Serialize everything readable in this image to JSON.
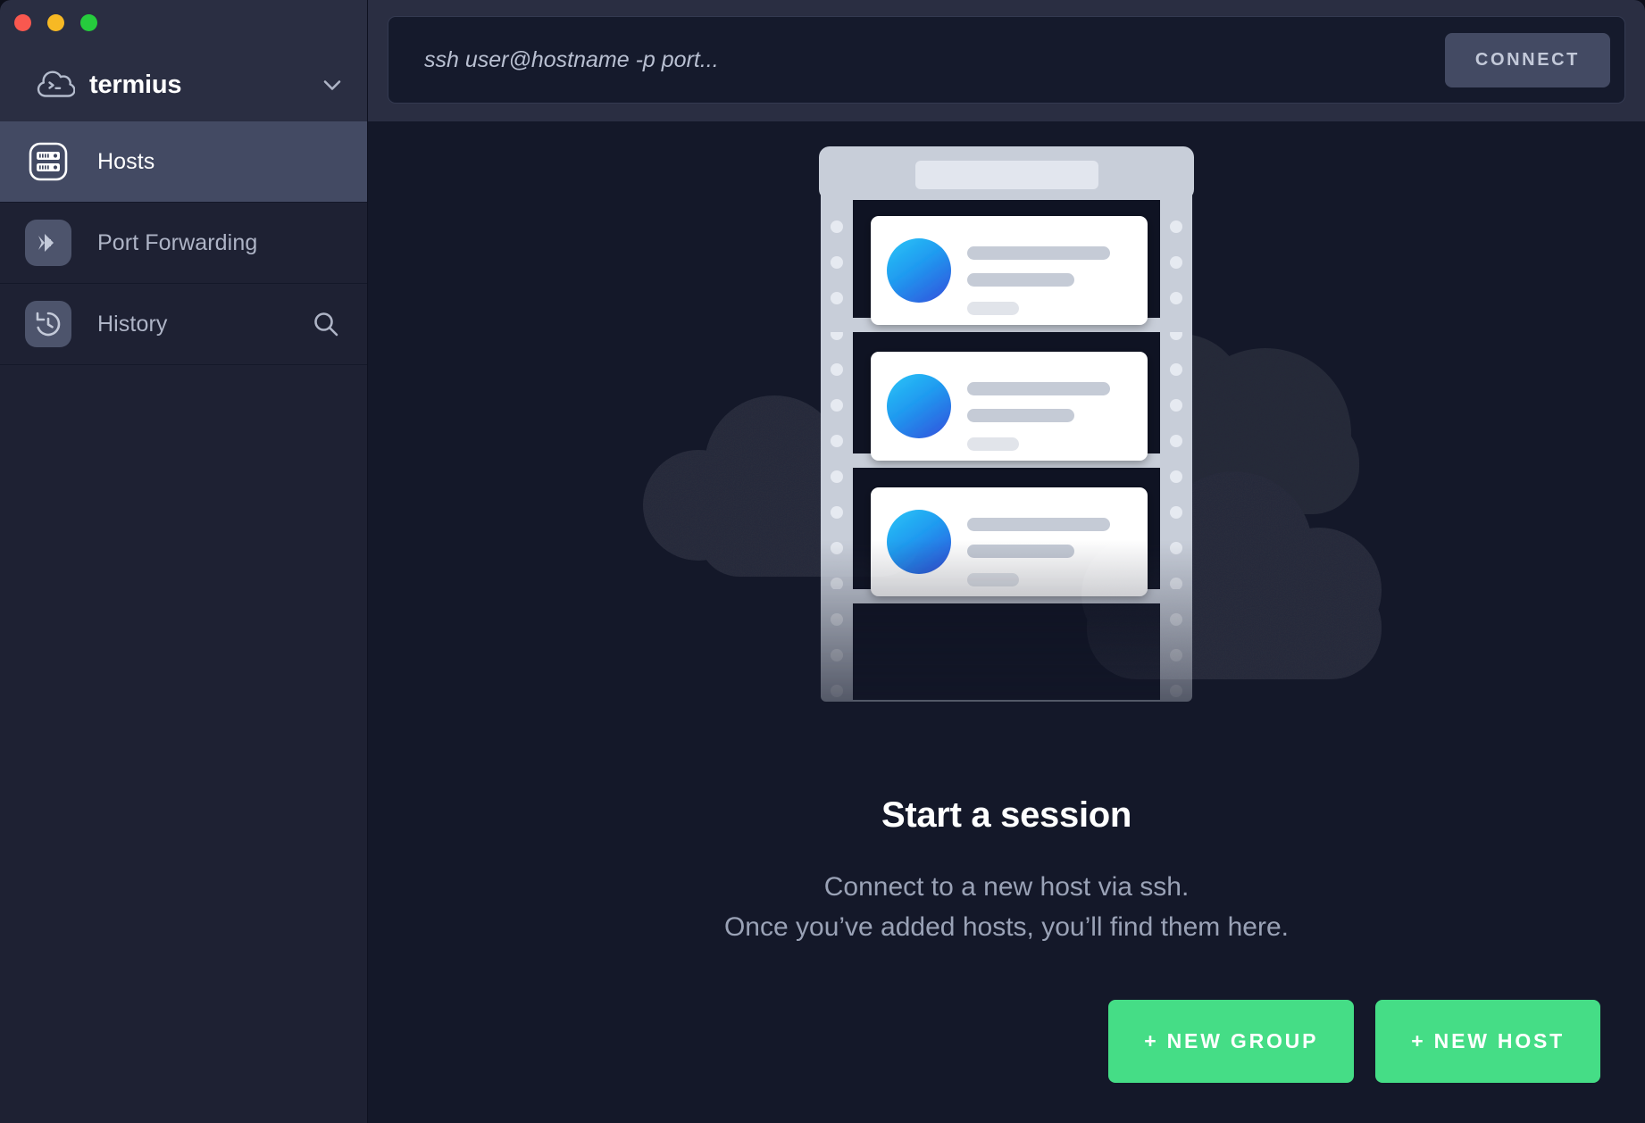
{
  "window": {
    "traffic_lights": [
      {
        "name": "close",
        "color": "#f9584f"
      },
      {
        "name": "minimize",
        "color": "#f7b924"
      },
      {
        "name": "zoom",
        "color": "#26cc3d"
      }
    ]
  },
  "sidebar": {
    "brand": {
      "title": "termius",
      "logo_icon": "cloud-terminal-icon",
      "chevron_icon": "chevron-down-icon"
    },
    "items": [
      {
        "label": "Hosts",
        "icon": "server-rack-icon",
        "active": true
      },
      {
        "label": "Port Forwarding",
        "icon": "forward-arrow-icon",
        "active": false
      },
      {
        "label": "History",
        "icon": "history-clock-icon",
        "active": false,
        "trailing_icon": "search-icon"
      }
    ]
  },
  "topbar": {
    "ssh_placeholder": "ssh user@hostname -p port...",
    "ssh_value": "",
    "connect_label": "CONNECT"
  },
  "empty_state": {
    "title": "Start a session",
    "subtitle_line1": "Connect to a new host via ssh.",
    "subtitle_line2": "Once you’ve added hosts, you’ll find them here.",
    "illustration": "server-rack-with-clouds"
  },
  "actions": {
    "new_group_label": "+ NEW GROUP",
    "new_host_label": "+ NEW HOST"
  },
  "colors": {
    "background": "#141829",
    "sidebar": "#1e2133",
    "titlebar": "#2a2e42",
    "active_item": "#434a63",
    "accent_green": "#45dd86",
    "muted_text": "#9aa2b6",
    "cloud": "#2d3142",
    "rack_frame": "#c8ced9",
    "sphere_from": "#29b6f6",
    "sphere_to": "#2563eb"
  }
}
